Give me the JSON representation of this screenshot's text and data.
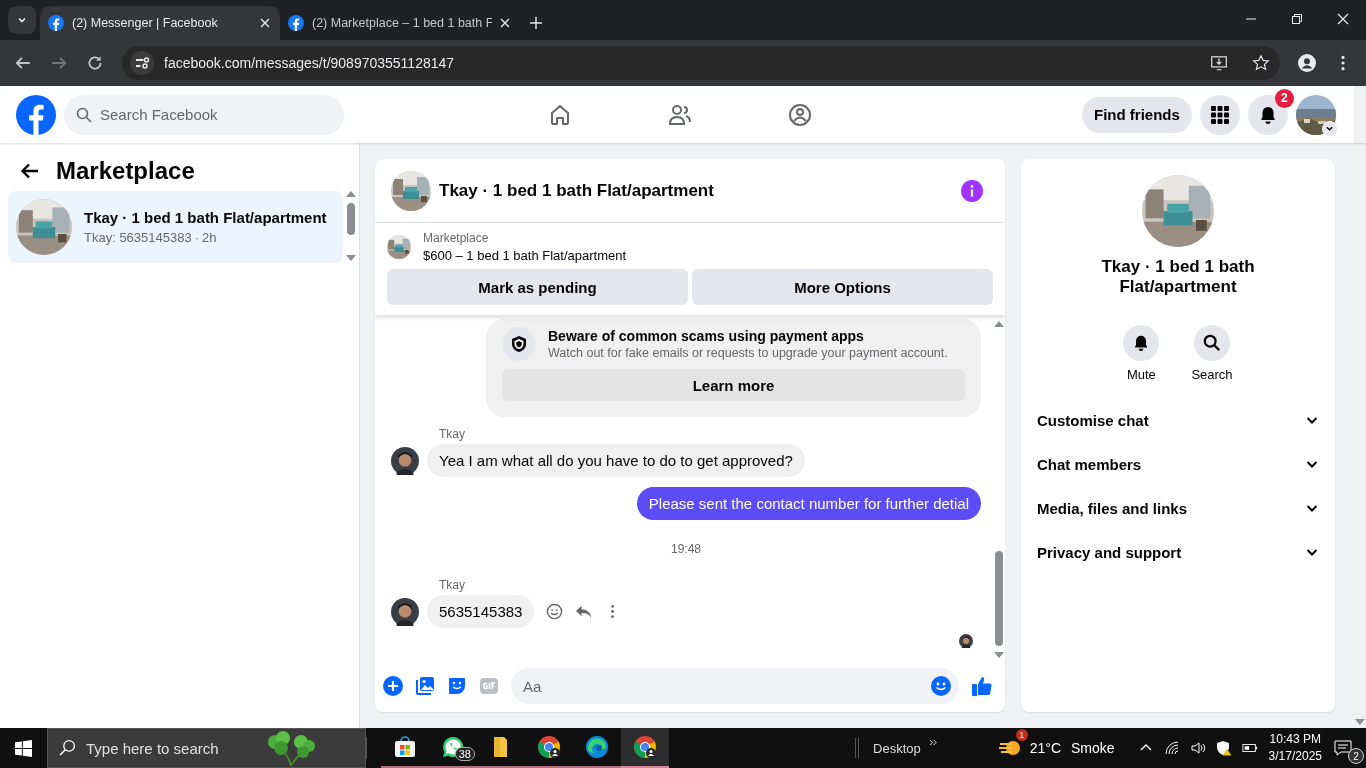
{
  "browser": {
    "tabs": [
      {
        "title": "(2) Messenger | Facebook",
        "selected": true
      },
      {
        "title": "(2) Marketplace – 1 bed 1 bath F",
        "selected": false
      }
    ],
    "url": "facebook.com/messages/t/9089703551128147"
  },
  "header": {
    "search_placeholder": "Search Facebook",
    "find_friends": "Find friends",
    "notification_badge": "2"
  },
  "left_panel": {
    "title": "Marketplace",
    "conversations": [
      {
        "name": "Tkay · 1 bed 1 bath Flat/apartment",
        "preview": "Tkay: 5635145383",
        "separator": "·",
        "time": "2h",
        "selected": true
      }
    ]
  },
  "chat": {
    "title": "Tkay · 1 bed 1 bath Flat/apartment",
    "listing": {
      "label": "Marketplace",
      "title": "$600 – 1 bed 1 bath Flat/apartment"
    },
    "actions": [
      "Mark as pending",
      "More Options"
    ],
    "notice": {
      "title": "Beware of common scams using payment apps",
      "text": "Watch out for fake emails or requests to upgrade your payment account.",
      "button": "Learn more"
    },
    "messages": [
      {
        "kind": "incoming",
        "sender": "Tkay",
        "text": "Yea I am what all do you have to do to get approved?"
      },
      {
        "kind": "outgoing",
        "text": "Please sent the contact number for further detial"
      },
      {
        "kind": "time",
        "text": "19:48"
      },
      {
        "kind": "incoming",
        "sender": "Tkay",
        "text": "5635145383",
        "hovered": true
      }
    ],
    "composer_placeholder": "Aa"
  },
  "details": {
    "name": "Tkay · 1 bed 1 bath Flat/apartment",
    "actions": [
      {
        "kind": "bell",
        "label": "Mute"
      },
      {
        "kind": "search",
        "label": "Search"
      }
    ],
    "sections": [
      {
        "label": "Customise chat",
        "expanded": false
      },
      {
        "label": "Chat members",
        "expanded": false
      },
      {
        "label": "Media, files and links",
        "expanded": false
      },
      {
        "label": "Privacy and support",
        "expanded": false
      }
    ]
  },
  "taskbar": {
    "search_placeholder": "Type here to search",
    "apps": [
      {
        "kind": "store",
        "active": false
      },
      {
        "kind": "whatsapp",
        "badge": "38",
        "active": false
      },
      {
        "kind": "folder",
        "active": false
      },
      {
        "kind": "chrome",
        "active": false
      },
      {
        "kind": "edge",
        "active": false
      },
      {
        "kind": "chrome",
        "active": true
      }
    ],
    "desktop_label": "Desktop",
    "weather_badge": "1",
    "temperature": "21°C",
    "condition": "Smoke",
    "time": "10:43 PM",
    "date": "3/17/2025",
    "notification_count": "2"
  }
}
